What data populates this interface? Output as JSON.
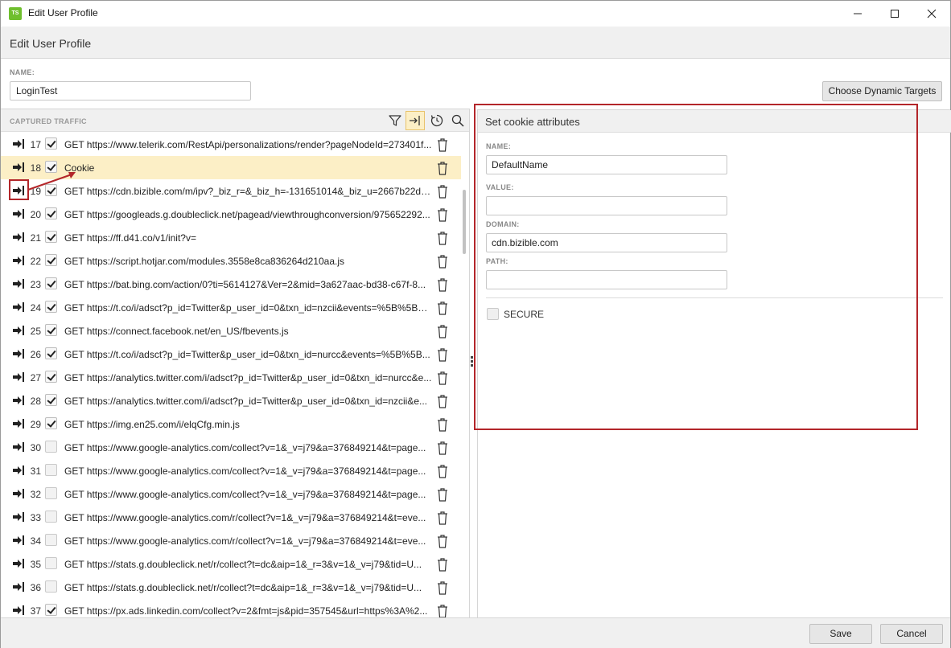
{
  "window": {
    "title": "Edit User Profile",
    "app_icon": "TS",
    "controls": [
      "minimize-icon",
      "maximize-icon",
      "close-icon"
    ]
  },
  "header": {
    "title": "Edit User Profile"
  },
  "profile": {
    "name_label": "NAME:",
    "name_value": "LoginTest",
    "dynamic_targets_label": "Choose Dynamic Targets"
  },
  "traffic": {
    "title": "CAPTURED TRAFFIC",
    "tools": [
      "filter-icon",
      "goto-icon",
      "refresh-icon",
      "search-icon"
    ],
    "rows": [
      {
        "num": "17",
        "checked": true,
        "text": "GET https://www.telerik.com/RestApi/personalizations/render?pageNodeId=273401f...",
        "selected": false
      },
      {
        "num": "18",
        "checked": true,
        "text": "Cookie",
        "selected": true
      },
      {
        "num": "19",
        "checked": true,
        "text": "GET https://cdn.bizible.com/m/ipv?_biz_r=&_biz_h=-131651014&_biz_u=2667b22d3...",
        "selected": false
      },
      {
        "num": "20",
        "checked": true,
        "text": "GET https://googleads.g.doubleclick.net/pagead/viewthroughconversion/975652292...",
        "selected": false
      },
      {
        "num": "21",
        "checked": true,
        "text": "GET https://ff.d41.co/v1/init?v=",
        "selected": false
      },
      {
        "num": "22",
        "checked": true,
        "text": "GET https://script.hotjar.com/modules.3558e8ca836264d210aa.js",
        "selected": false
      },
      {
        "num": "23",
        "checked": true,
        "text": "GET https://bat.bing.com/action/0?ti=5614127&Ver=2&mid=3a627aac-bd38-c67f-8...",
        "selected": false
      },
      {
        "num": "24",
        "checked": true,
        "text": "GET https://t.co/i/adsct?p_id=Twitter&p_user_id=0&txn_id=nzcii&events=%5B%5B%...",
        "selected": false
      },
      {
        "num": "25",
        "checked": true,
        "text": "GET https://connect.facebook.net/en_US/fbevents.js",
        "selected": false
      },
      {
        "num": "26",
        "checked": true,
        "text": "GET https://t.co/i/adsct?p_id=Twitter&p_user_id=0&txn_id=nurcc&events=%5B%5B...",
        "selected": false
      },
      {
        "num": "27",
        "checked": true,
        "text": "GET https://analytics.twitter.com/i/adsct?p_id=Twitter&p_user_id=0&txn_id=nurcc&e...",
        "selected": false
      },
      {
        "num": "28",
        "checked": true,
        "text": "GET https://analytics.twitter.com/i/adsct?p_id=Twitter&p_user_id=0&txn_id=nzcii&e...",
        "selected": false
      },
      {
        "num": "29",
        "checked": true,
        "text": "GET https://img.en25.com/i/elqCfg.min.js",
        "selected": false
      },
      {
        "num": "30",
        "checked": false,
        "text": "GET https://www.google-analytics.com/collect?v=1&_v=j79&a=376849214&t=page...",
        "selected": false
      },
      {
        "num": "31",
        "checked": false,
        "text": "GET https://www.google-analytics.com/collect?v=1&_v=j79&a=376849214&t=page...",
        "selected": false
      },
      {
        "num": "32",
        "checked": false,
        "text": "GET https://www.google-analytics.com/collect?v=1&_v=j79&a=376849214&t=page...",
        "selected": false
      },
      {
        "num": "33",
        "checked": false,
        "text": "GET https://www.google-analytics.com/r/collect?v=1&_v=j79&a=376849214&t=eve...",
        "selected": false
      },
      {
        "num": "34",
        "checked": false,
        "text": "GET https://www.google-analytics.com/r/collect?v=1&_v=j79&a=376849214&t=eve...",
        "selected": false
      },
      {
        "num": "35",
        "checked": false,
        "text": "GET https://stats.g.doubleclick.net/r/collect?t=dc&aip=1&_r=3&v=1&_v=j79&tid=U...",
        "selected": false
      },
      {
        "num": "36",
        "checked": false,
        "text": "GET https://stats.g.doubleclick.net/r/collect?t=dc&aip=1&_r=3&v=1&_v=j79&tid=U...",
        "selected": false
      },
      {
        "num": "37",
        "checked": true,
        "text": "GET https://px.ads.linkedin.com/collect?v=2&fmt=js&pid=357545&url=https%3A%2...",
        "selected": false
      }
    ]
  },
  "cookie": {
    "title": "Set cookie attributes",
    "name_label": "NAME:",
    "name_value": "DefaultName",
    "value_label": "VALUE:",
    "value_value": "",
    "domain_label": "DOMAIN:",
    "domain_value": "cdn.bizible.com",
    "path_label": "PATH:",
    "path_value": "",
    "secure_label": "SECURE",
    "secure_checked": false
  },
  "footer": {
    "save_label": "Save",
    "cancel_label": "Cancel"
  },
  "colors": {
    "selected_row": "#fcefc6",
    "annotation": "#b3262a",
    "panel_bg": "#f0f0f0"
  }
}
